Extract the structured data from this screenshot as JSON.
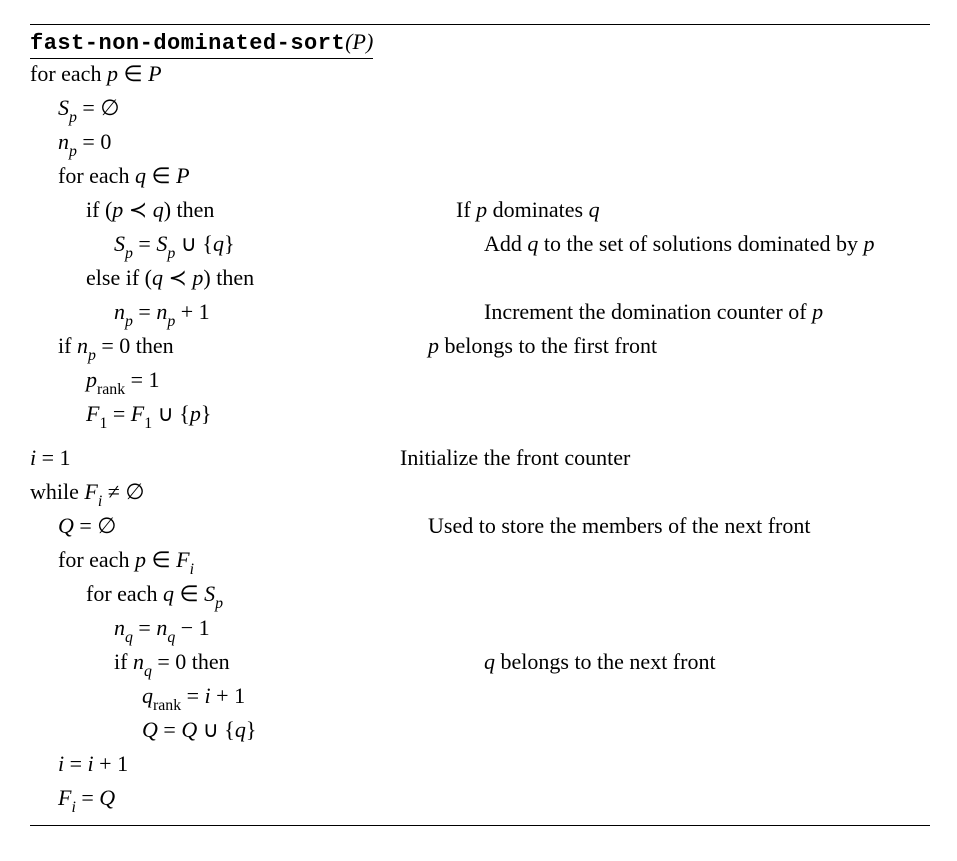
{
  "title_func": "fast-non-dominated-sort",
  "title_arg_open": "(",
  "title_arg": "P",
  "title_arg_close": ")",
  "comments": {
    "dominates": "If p dominates q",
    "add_q": "Add q to the set of solutions dominated by p",
    "increment": "Increment the domination counter of p",
    "first_front": "p belongs to the first front",
    "init_counter": "Initialize the front counter",
    "store_next": "Used to store the members of the next front",
    "next_front": "q belongs to the next front"
  },
  "code": {
    "for_each_p": "for each p ∈ P",
    "sp_empty": "S_p = ∅",
    "np_zero": "n_p = 0",
    "for_each_q": "for each q ∈ P",
    "if_p_dom_q": "if (p ≺ q) then",
    "sp_union": "S_p = S_p ∪ {q}",
    "elif_q_dom_p": "else if (q ≺ p) then",
    "np_inc": "n_p = n_p + 1",
    "if_np_zero": "if n_p = 0 then",
    "prank_one": "p_rank = 1",
    "f1_union": "F_1 = F_1 ∪ {p}",
    "i_one": "i = 1",
    "while_fi": "while F_i ≠ ∅",
    "q_empty": "Q = ∅",
    "for_each_p_fi": "for each p ∈ F_i",
    "for_each_q_sp": "for each q ∈ S_p",
    "nq_dec": "n_q = n_q − 1",
    "if_nq_zero": "if n_q = 0 then",
    "qrank": "q_rank = i + 1",
    "qset_union": "Q = Q ∪ {q}",
    "i_inc": "i = i + 1",
    "fi_q": "F_i = Q"
  }
}
